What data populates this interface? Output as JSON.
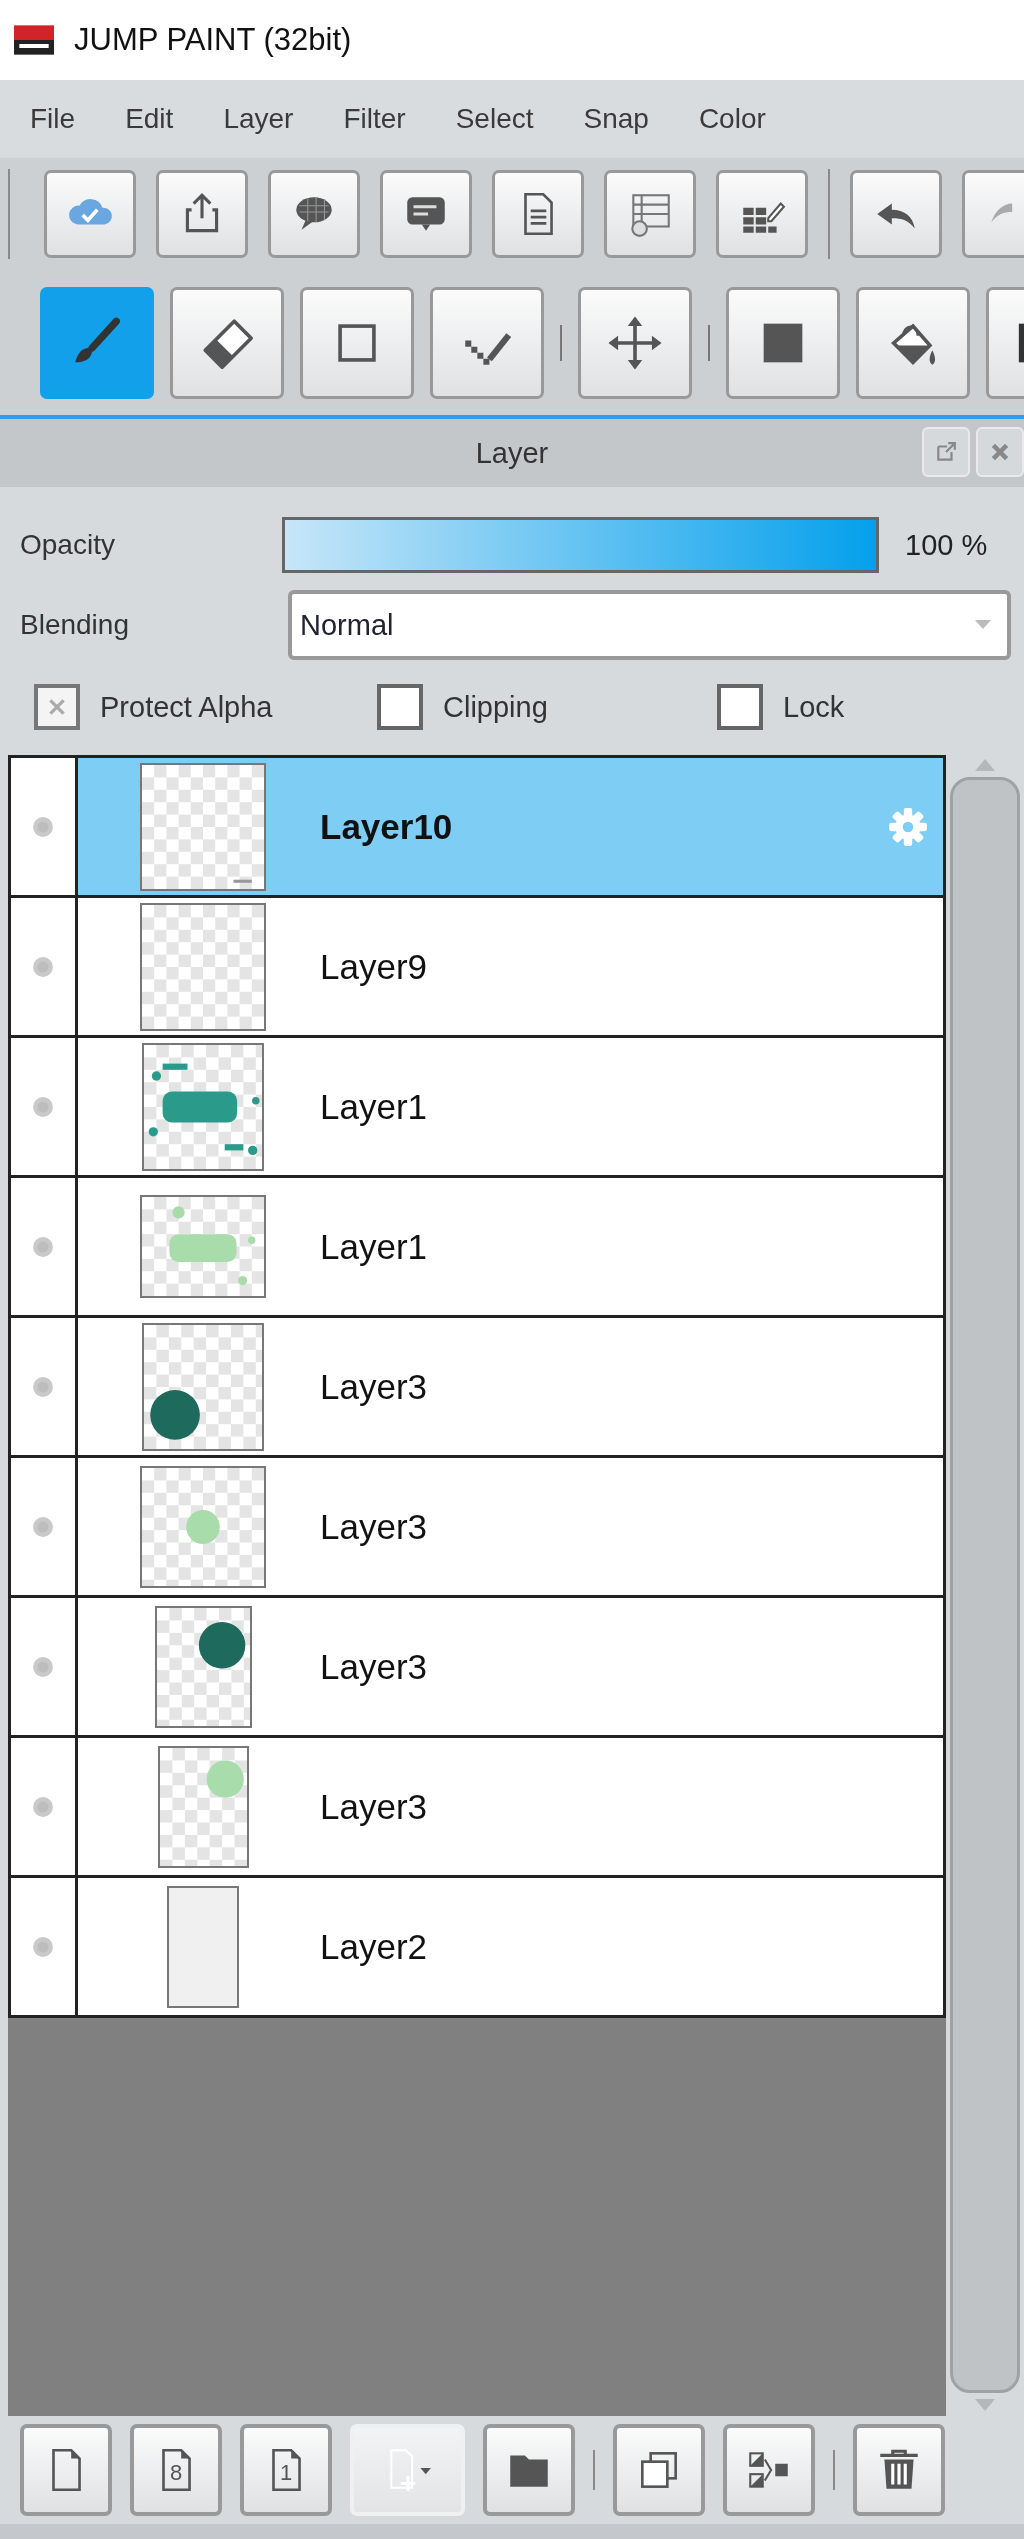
{
  "window": {
    "title": "JUMP PAINT (32bit)"
  },
  "menu": [
    "File",
    "Edit",
    "Layer",
    "Filter",
    "Select",
    "Snap",
    "Color"
  ],
  "toolbar_top": [
    {
      "kind": "cloud"
    },
    {
      "kind": "share"
    },
    {
      "kind": "balloon"
    },
    {
      "kind": "comment"
    },
    {
      "kind": "document"
    },
    {
      "kind": "table-clock"
    },
    {
      "kind": "grid-edit"
    },
    {
      "kind": "separator"
    },
    {
      "kind": "undo"
    },
    {
      "kind": "redo"
    }
  ],
  "toolbar_tools": [
    {
      "kind": "brush",
      "selected": true
    },
    {
      "kind": "eraser",
      "selected": false
    },
    {
      "kind": "rect-select",
      "selected": false
    },
    {
      "kind": "dot-pen",
      "selected": false
    },
    {
      "kind": "separator"
    },
    {
      "kind": "move",
      "selected": false
    },
    {
      "kind": "separator"
    },
    {
      "kind": "fill-square",
      "selected": false
    },
    {
      "kind": "bucket",
      "selected": false
    },
    {
      "kind": "partial",
      "selected": false
    }
  ],
  "layer_panel": {
    "title": "Layer",
    "opacity": {
      "label": "Opacity",
      "level": 1.0,
      "reading": "100 %"
    },
    "blending": {
      "label": "Blending",
      "value": "Normal"
    },
    "options": [
      {
        "label": "Protect Alpha",
        "checked": true
      },
      {
        "label": "Clipping",
        "checked": false
      },
      {
        "label": "Lock",
        "checked": false
      }
    ],
    "layers": [
      {
        "name": "Layer10",
        "selected": true
      },
      {
        "name": "Layer9",
        "selected": false
      },
      {
        "name": "Layer1",
        "selected": false
      },
      {
        "name": "Layer1",
        "selected": false
      },
      {
        "name": "Layer3",
        "selected": false
      },
      {
        "name": "Layer3",
        "selected": false
      },
      {
        "name": "Layer3",
        "selected": false
      },
      {
        "name": "Layer3",
        "selected": false
      },
      {
        "name": "Layer2",
        "selected": false
      }
    ],
    "bottom_toolbar": [
      {
        "kind": "new",
        "disabled": false
      },
      {
        "kind": "new",
        "label": "8",
        "disabled": false
      },
      {
        "kind": "new",
        "label": "1",
        "disabled": false
      },
      {
        "kind": "add-menu",
        "disabled": true
      },
      {
        "kind": "folder",
        "disabled": false
      },
      {
        "kind": "separator"
      },
      {
        "kind": "duplicate",
        "disabled": false
      },
      {
        "kind": "merge",
        "disabled": false
      },
      {
        "kind": "separator"
      },
      {
        "kind": "delete",
        "disabled": false
      }
    ]
  }
}
